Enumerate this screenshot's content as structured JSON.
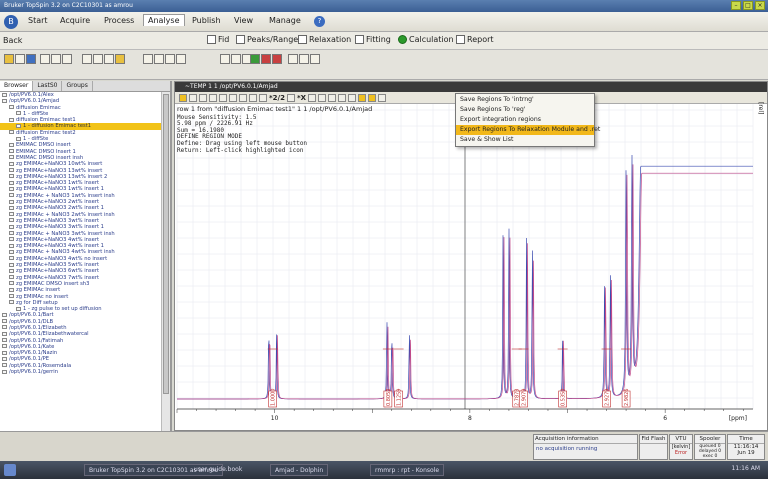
{
  "window": {
    "title": "Bruker TopSpin 3.2 on C2C10301 as amrou"
  },
  "menubar": {
    "items": [
      "Start",
      "Acquire",
      "Process",
      "Analyse",
      "Publish",
      "View",
      "Manage"
    ],
    "active": "Analyse",
    "help": "?"
  },
  "subrow": {
    "back": "Back",
    "items": [
      "Fid",
      "Peaks/Ranges",
      "Relaxation",
      "Fitting",
      "Calculation",
      "Report"
    ]
  },
  "browser": {
    "tabs": [
      "Browser",
      "LastS0",
      "Groups"
    ],
    "items": [
      "/opt/PV6.0.1/Alex",
      "/opt/PV6.0.1/Amjad",
      "diffusion Emimac",
      "1 - diffSte",
      "diffusion Emimac test1",
      "1 - diffusion Emimac test1",
      "diffusion Emimac test2",
      "1 - diffSte",
      "EMIMAC DMSO insert",
      "EMIMAC DMSO Insert 1",
      "EMIMAC DMSO insert insh",
      "zg EMIMAc+NaNO3 10wt% insert",
      "zg EMIMAc+NaNO3 13wt% insert",
      "zg EMIMAc+NaNO3 13wt% insert 2",
      "zg EMIMAc+NaNO3 1wt% insert",
      "zg EMIMAc+NaNO3 1wt% insert 1",
      "zg EMIMAc + NaNO3 1wt% insert insh",
      "zg EMIMAc+NaNO3 2wt% insert",
      "zg EMIMAc+NaNO3 2wt% insert 1",
      "zg EMIMAc + NaNO3 2wt% insert insh",
      "zg EMIMAc+NaNO3 3wt% insert",
      "zg EMIMAc+NaNO3 3wt% insert 1",
      "zg EMIMAc + NaNO3 3wt% insert insh",
      "zg EMIMAc+NaNO3 4wt% insert",
      "zg EMIMAc+NaNO3 4wt% insert 1",
      "zg EMIMAc + NaNO3 4wt% insert insh",
      "zg EMIMAc+NaNO3 4wt% no insert",
      "zg EMIMAc+NaNO3 5wt% insert",
      "zg EMIMAc+NaNO3 6wt% insert",
      "zg EMIMAc+NaNO3 7wt% insert",
      "zg EMIMAC DMSO insert sh3",
      "zg EMIMAc insert",
      "zg EMIMAc no insert",
      "zg for Diff setup",
      "1 - zg pulse to set up diffusion",
      "/opt/PV6.0.1/Bart",
      "/opt/PV6.0.1/DLB",
      "/opt/PV6.0.1/Elizabeth",
      "/opt/PV6.0.1/Elizabethwatercal",
      "/opt/PV6.0.1/Fatimah",
      "/opt/PV6.0.1/Kate",
      "/opt/PV6.0.1/Nazin",
      "/opt/PV6.0.1/PE",
      "/opt/PV6.0.1/Rosemdala",
      "/opt/PV6.0.1/gerrin"
    ],
    "selected_index": 5
  },
  "spectrum": {
    "header": "~TEMP 1 1 /opt/PV6.0.1/Amjad",
    "toolbar_value": "*2/2",
    "toolbar_value2": "*X",
    "info_title": "row 1 from \"diffusion Emimac test1\" 1 1 /opt/PV6.0.1/Amjad",
    "info_lines": [
      "Mouse Sensitivity: 1.5",
      "5.98 ppm / 2226.91 Hz",
      "Sum = 16.1980",
      "DEFINE REGION MODE",
      "Define: Drag using left mouse button",
      "Return: Left-click highlighted icon"
    ],
    "x_axis_label": "[ppm]",
    "y_axis_label": "[rel]",
    "x_ticks": [
      "10",
      "8",
      "6"
    ]
  },
  "context_menu": {
    "items": [
      "Save Regions To 'intrng'",
      "Save Regions To 'reg'",
      "Export integration regions",
      "Export Regions To Relaxation Module and .ret",
      "Save & Show List"
    ],
    "highlighted_index": 3
  },
  "chart_data": {
    "type": "line",
    "xlabel": "[ppm]",
    "ylabel": "[rel]",
    "x_reversed": true,
    "xlim": [
      11.0,
      5.1
    ],
    "series": [
      {
        "values": []
      },
      {
        "values": []
      }
    ],
    "x_ticks": [
      10,
      8,
      6
    ],
    "regions": [
      {
        "label": "1.0000"
      },
      {
        "label": "0.8053"
      },
      {
        "label": "1.1259"
      },
      {
        "label": "2.7873"
      },
      {
        "label": "2.9079"
      },
      {
        "label": "0.5350"
      },
      {
        "label": "2.9279"
      },
      {
        "label": "2.9826"
      }
    ]
  },
  "status": {
    "acquisition_header": "Acquisition information",
    "acquisition_value": "no acquisition running",
    "fidflash": "Fid Flash",
    "vtu_header": "VTU",
    "vtu_value": "[kelvin]",
    "vtu_error": "Error",
    "spooler": "Spooler",
    "spooler_values": [
      "queued 0",
      "delayed 0",
      "exec 0"
    ],
    "time_header": "Time",
    "time_value": "11:16:14",
    "date_value": "Jun 19"
  },
  "taskbar": {
    "tasks": [
      "Bruker TopSpin 3.2 on C2C10301 as amrou",
      "user guide.book",
      "Amjad - Dolphin",
      "rmmrp : rpt - Konsole"
    ],
    "clock": "11:16 AM"
  }
}
